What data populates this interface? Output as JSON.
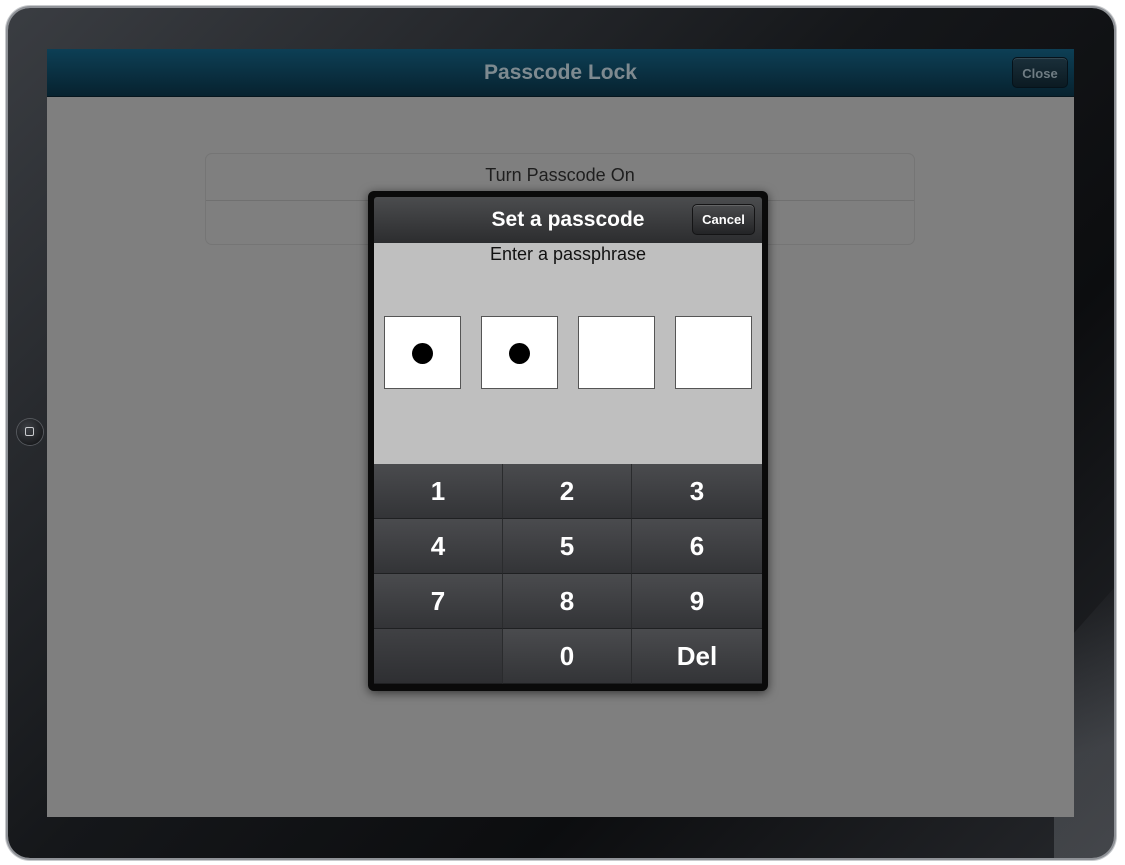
{
  "navbar": {
    "title": "Passcode Lock",
    "close_label": "Close"
  },
  "settings": {
    "rows": [
      {
        "label": "Turn Passcode On"
      },
      {
        "label": ""
      }
    ]
  },
  "passcode_dialog": {
    "title": "Set a passcode",
    "cancel_label": "Cancel",
    "prompt": "Enter a passphrase",
    "total_digits": 4,
    "entered_digits": 2
  },
  "keypad": {
    "keys": [
      "1",
      "2",
      "3",
      "4",
      "5",
      "6",
      "7",
      "8",
      "9",
      "",
      "0",
      "Del"
    ]
  },
  "colors": {
    "navbar": "#0d3f55",
    "screen_dim": "#7f7f7f",
    "entry_background": "#bfbfbf",
    "keypad": "#3a3b3e"
  }
}
